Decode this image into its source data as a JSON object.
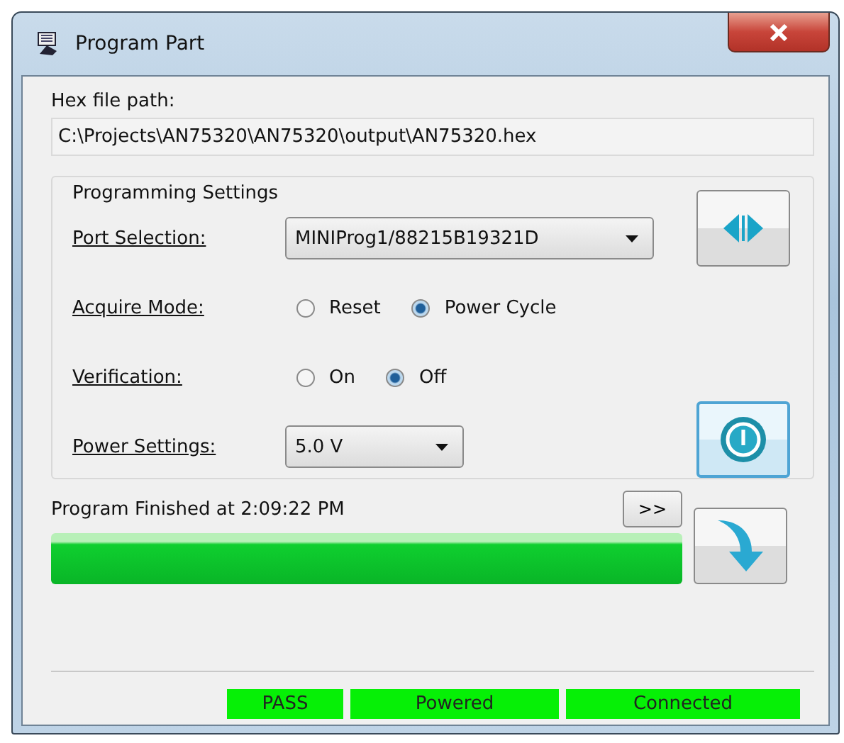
{
  "window": {
    "title": "Program Part"
  },
  "hex_file": {
    "label": "Hex file path:",
    "value": "C:\\Projects\\AN75320\\AN75320\\output\\AN75320.hex"
  },
  "programming_settings": {
    "title": "Programming Settings",
    "port_selection": {
      "label": "Port Selection:",
      "value": "MINIProg1/88215B19321D"
    },
    "acquire_mode": {
      "label": "Acquire Mode:",
      "options": [
        {
          "label": "Reset",
          "selected": false
        },
        {
          "label": "Power Cycle",
          "selected": true
        }
      ]
    },
    "verification": {
      "label": "Verification:",
      "options": [
        {
          "label": "On",
          "selected": false
        },
        {
          "label": "Off",
          "selected": true
        }
      ]
    },
    "power_settings": {
      "label": "Power Settings:",
      "value": "5.0 V"
    }
  },
  "progress": {
    "status": "Program Finished at 2:09:22 PM",
    "expand_button": ">>",
    "level": 1
  },
  "status_bar": [
    {
      "text": "PASS"
    },
    {
      "text": "Powered"
    },
    {
      "text": "Connected"
    }
  ]
}
